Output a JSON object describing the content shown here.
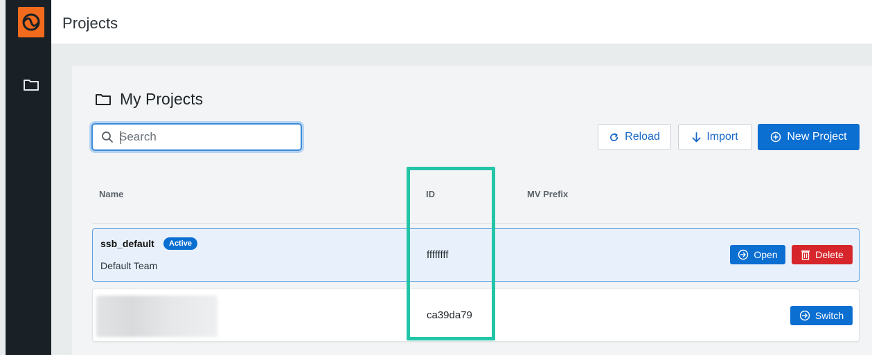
{
  "header": {
    "title": "Projects"
  },
  "section": {
    "title": "My Projects"
  },
  "search": {
    "placeholder": "Search",
    "value": ""
  },
  "toolbar": {
    "reload_label": "Reload",
    "import_label": "Import",
    "new_project_label": "New Project"
  },
  "table": {
    "columns": [
      "Name",
      "ID",
      "MV Prefix"
    ],
    "rows": [
      {
        "name": "ssb_default",
        "badge": "Active",
        "team": "Default Team",
        "id": "ffffffff",
        "mv_prefix": "",
        "actions": [
          "Open",
          "Delete"
        ]
      },
      {
        "name": "",
        "team": "",
        "id": "ca39da79",
        "mv_prefix": "",
        "actions": [
          "Switch"
        ]
      }
    ]
  },
  "colors": {
    "brand_orange": "#f26b1d",
    "rail_dark": "#192127",
    "primary_blue": "#0b6ed1",
    "danger_red": "#d7262b",
    "highlight_teal": "#22c5a7"
  },
  "icons": {
    "logo": "app-logo-icon",
    "rail": "folder-icon",
    "reload": "refresh-icon",
    "import": "arrow-down-icon",
    "new": "plus-circle-icon",
    "open": "arrow-right-circle-icon",
    "delete": "trash-icon",
    "switch": "arrow-right-circle-icon"
  }
}
